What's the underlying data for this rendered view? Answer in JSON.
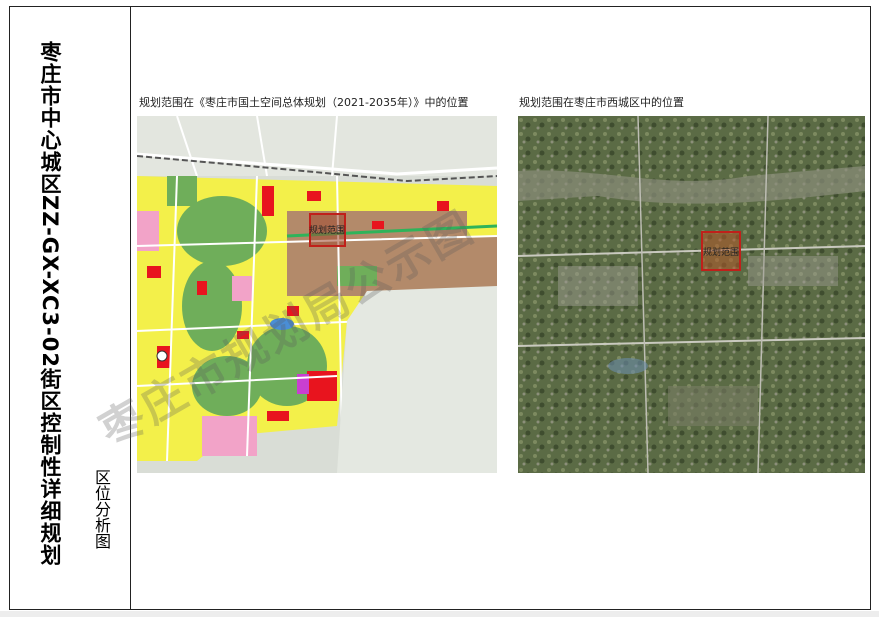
{
  "sheet": {
    "title": "枣庄市中心城区ZZ-GX-XC3-02街区控制性详细规划",
    "subtitle": "区位分析图"
  },
  "left_map": {
    "caption": "规划范围在《枣庄市国土空间总体规划（2021-2035年）》中的位置",
    "box_label": "规划范围"
  },
  "right_map": {
    "caption": "规划范围在枣庄市西城区中的位置",
    "box_label": "规划范围"
  },
  "watermark": "枣庄市规划局公示图",
  "colors": {
    "residential": "#f3f04a",
    "green": "#6fae5a",
    "commercial": "#e8141e",
    "public": "#f2a3c8",
    "industrial": "#b38a6a",
    "base": "#d9ddd6",
    "boundary": "#c0201a"
  }
}
